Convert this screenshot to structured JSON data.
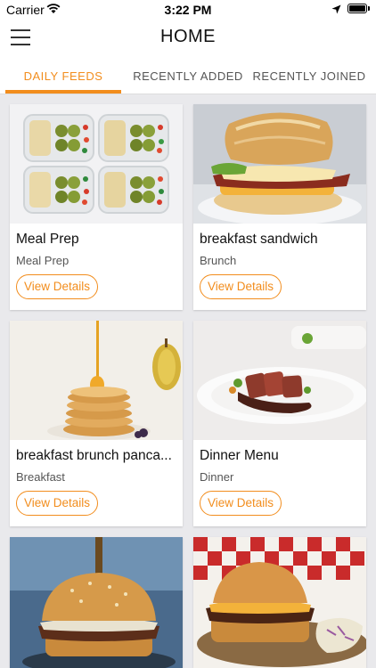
{
  "status_bar": {
    "carrier": "Carrier",
    "time": "3:22 PM"
  },
  "header": {
    "title": "HOME",
    "menu_icon": "hamburger-menu-icon"
  },
  "tabs": [
    {
      "label": "DAILY FEEDS",
      "active": true
    },
    {
      "label": "RECENTLY ADDED",
      "active": false
    },
    {
      "label": "RECENTLY JOINED",
      "active": false
    }
  ],
  "colors": {
    "accent": "#f28d1d",
    "background": "#e9e9ec"
  },
  "cards": [
    {
      "title": "Meal Prep",
      "category": "Meal Prep",
      "button": "View Details"
    },
    {
      "title": "breakfast sandwich",
      "category": "Brunch",
      "button": "View Details"
    },
    {
      "title": "breakfast brunch panca...",
      "category": "Breakfast",
      "button": "View Details"
    },
    {
      "title": "Dinner Menu",
      "category": "Dinner",
      "button": "View Details"
    }
  ]
}
